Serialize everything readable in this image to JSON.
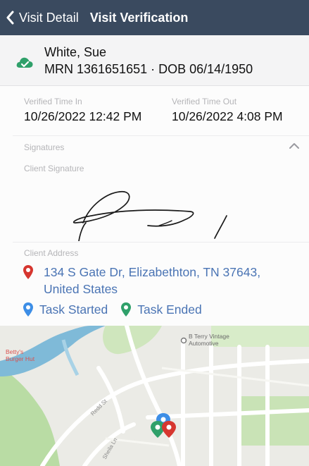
{
  "nav": {
    "back_label": "Visit Detail",
    "title": "Visit Verification"
  },
  "patient": {
    "name": "White, Sue",
    "mrn_dob": "MRN 1361651651 · DOB 06/14/1950"
  },
  "times": {
    "in_label": "Verified Time In",
    "in_value": "10/26/2022 12:42 PM",
    "out_label": "Verified Time Out",
    "out_value": "10/26/2022 4:08 PM"
  },
  "signatures": {
    "header": "Signatures",
    "client_label": "Client Signature"
  },
  "address": {
    "label": "Client Address",
    "line1": "134 S Gate Dr, Elizabethton, TN 37643,",
    "line2": "United States"
  },
  "legend": {
    "started": "Task Started",
    "ended": "Task Ended"
  },
  "map": {
    "poi_left": [
      "Betty's",
      "Burger Hut"
    ],
    "poi_right": [
      "B Terry Vintage",
      "Automotive"
    ],
    "street1": "Redd St",
    "street2": "Sheila Ln"
  },
  "colors": {
    "navbar": "#3a4a5f",
    "link": "#4a74b4",
    "start_pin": "#3d8ee6",
    "end_pin": "#2fa06a",
    "address_pin": "#d6362f",
    "river": "#7fbad8"
  }
}
